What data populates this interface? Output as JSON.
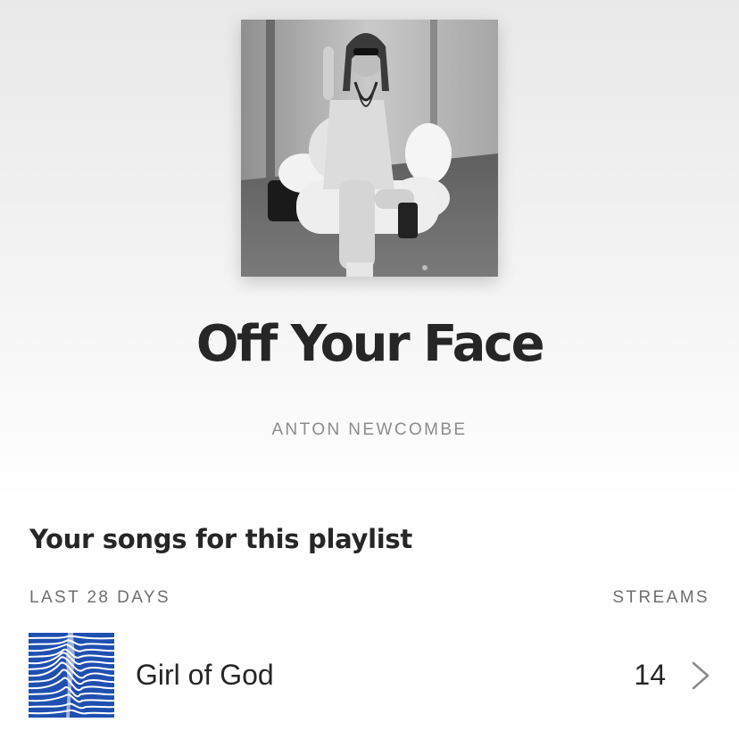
{
  "playlist": {
    "title": "Off Your Face",
    "artist": "ANTON NEWCOMBE",
    "cover_icon": "playlist-cover-photo"
  },
  "section": {
    "heading": "Your songs for this playlist",
    "period_label": "LAST 28 DAYS",
    "metric_label": "STREAMS"
  },
  "songs": [
    {
      "title": "Girl of God",
      "streams": "14",
      "art_icon": "album-art-blue-waves",
      "chevron_icon": "chevron-right-icon"
    }
  ],
  "colors": {
    "art_blue": "#1f4fb0",
    "text_dark": "#262626",
    "text_muted": "#8c8c8c"
  }
}
